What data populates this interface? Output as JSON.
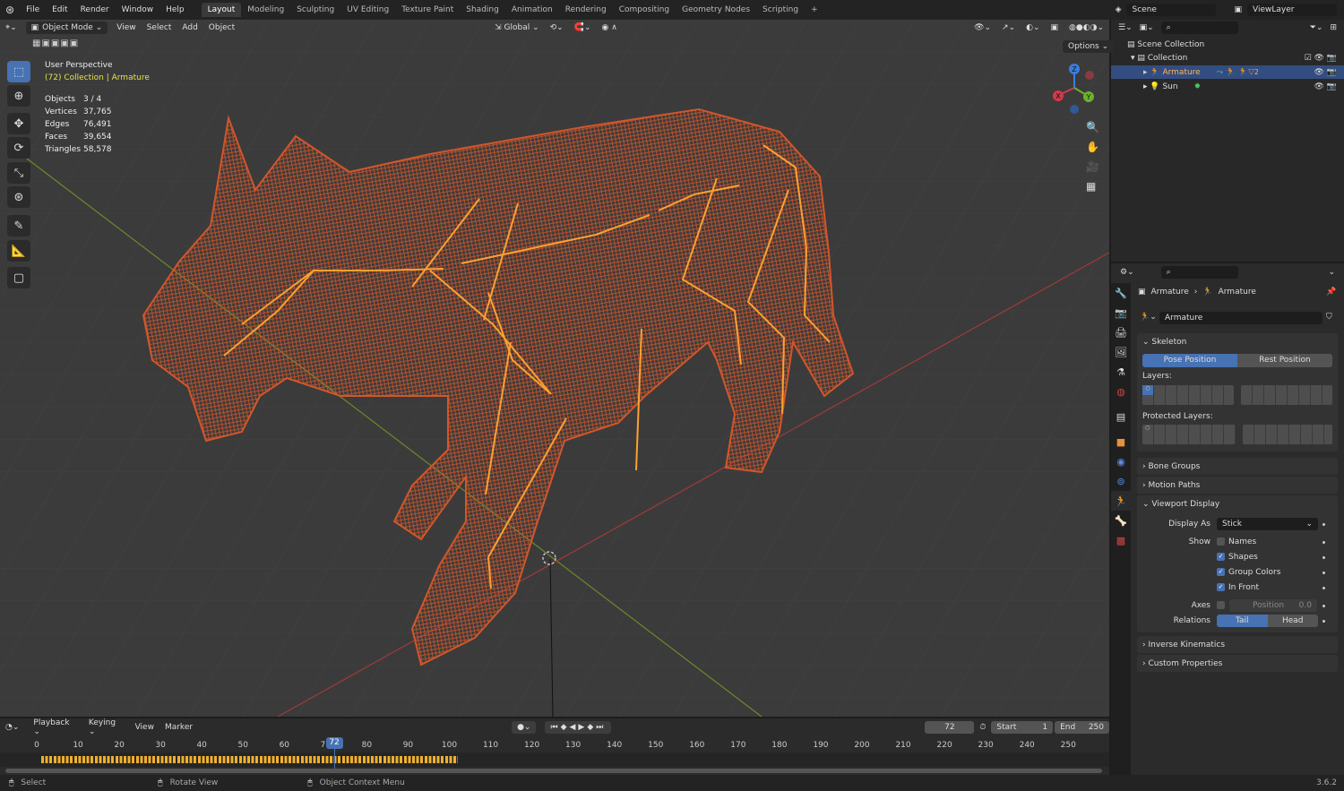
{
  "topbar": {
    "menus": [
      "File",
      "Edit",
      "Render",
      "Window",
      "Help"
    ],
    "workspaces": [
      "Layout",
      "Modeling",
      "Sculpting",
      "UV Editing",
      "Texture Paint",
      "Shading",
      "Animation",
      "Rendering",
      "Compositing",
      "Geometry Nodes",
      "Scripting"
    ],
    "active_workspace": "Layout",
    "scene": "Scene",
    "view_layer": "ViewLayer"
  },
  "viewport": {
    "mode": "Object Mode",
    "menus": [
      "View",
      "Select",
      "Add",
      "Object"
    ],
    "orientation": "Global",
    "options_label": "Options",
    "perspective": "User Perspective",
    "context": "(72) Collection | Armature",
    "stats": [
      {
        "label": "Objects",
        "value": "3 / 4"
      },
      {
        "label": "Vertices",
        "value": "37,765"
      },
      {
        "label": "Edges",
        "value": "76,491"
      },
      {
        "label": "Faces",
        "value": "39,654"
      },
      {
        "label": "Triangles",
        "value": "58,578"
      }
    ],
    "gizmo": {
      "x": "X",
      "y": "Y",
      "z": "Z"
    },
    "mesh_color": "#d2562a",
    "bone_color": "#ffa030"
  },
  "outliner": {
    "items": [
      {
        "label": "Scene Collection"
      },
      {
        "label": "Collection"
      },
      {
        "label": "Armature",
        "selected": true,
        "badge": "2"
      },
      {
        "label": "Sun"
      }
    ]
  },
  "properties": {
    "breadcrumb": [
      "Armature",
      "Armature"
    ],
    "data_name": "Armature",
    "skeleton": {
      "title": "Skeleton",
      "pose": "Pose Position",
      "rest": "Rest Position",
      "active": "Pose Position",
      "layers": "Layers:",
      "protected": "Protected Layers:"
    },
    "collapsed": [
      "Bone Groups",
      "Motion Paths"
    ],
    "viewport_display": {
      "title": "Viewport Display",
      "display_as_label": "Display As",
      "display_as": "Stick",
      "show_label": "Show",
      "names": "Names",
      "names_checked": false,
      "shapes": "Shapes",
      "shapes_checked": true,
      "group_colors": "Group Colors",
      "group_colors_checked": true,
      "in_front": "In Front",
      "in_front_checked": true,
      "axes_label": "Axes",
      "axes_checked": false,
      "position_label": "Position",
      "position_value": "0.0",
      "relations_label": "Relations",
      "tail": "Tail",
      "head": "Head",
      "relations_active": "Tail"
    },
    "collapsed2": [
      "Inverse Kinematics",
      "Custom Properties"
    ]
  },
  "timeline": {
    "menus": [
      "Playback",
      "Keying",
      "View",
      "Marker"
    ],
    "current_frame": "72",
    "start_label": "Start",
    "start": "1",
    "end_label": "End",
    "end": "250",
    "ticks": [
      "0",
      "10",
      "20",
      "30",
      "40",
      "50",
      "60",
      "70",
      "80",
      "90",
      "100",
      "110",
      "120",
      "130",
      "140",
      "150",
      "160",
      "170",
      "180",
      "190",
      "200",
      "210",
      "220",
      "230",
      "240",
      "250"
    ],
    "keyframe_range": [
      1,
      102
    ]
  },
  "status": {
    "select": "Select",
    "rotate": "Rotate View",
    "context_menu": "Object Context Menu",
    "version": "3.6.2"
  }
}
